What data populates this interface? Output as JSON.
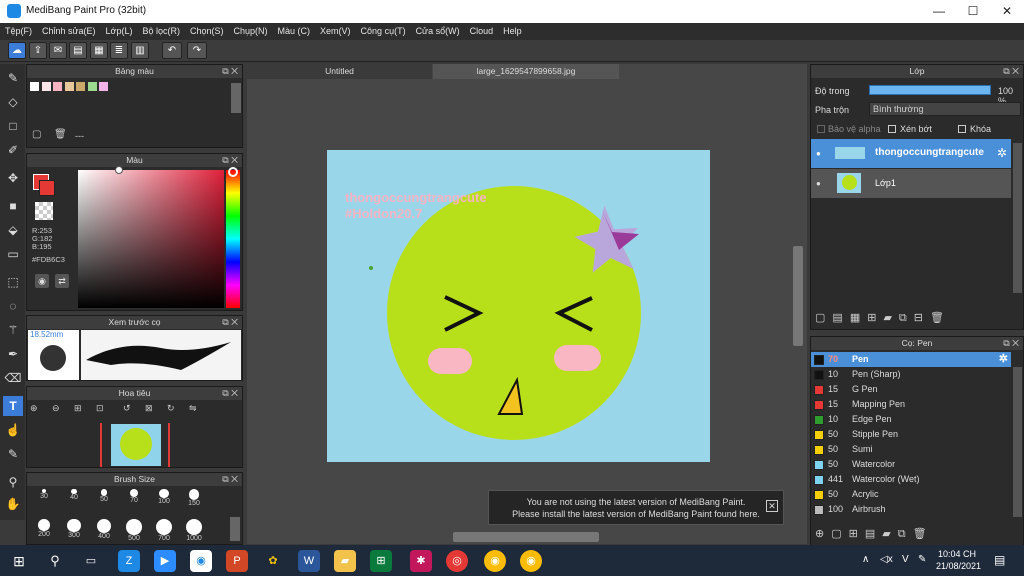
{
  "title": "MediBang Paint Pro (32bit)",
  "menu": [
    "Tệp(F)",
    "Chỉnh sửa(E)",
    "Lớp(L)",
    "Bộ lọc(R)",
    "Chọn(S)",
    "Chụp(N)",
    "Màu (C)",
    "Xem(V)",
    "Công cụ(T)",
    "Cửa sổ(W)",
    "Cloud",
    "Help"
  ],
  "panels": {
    "palette": "Bảng màu",
    "palette_count": "---",
    "color": "Màu",
    "preview": "Xem trước cọ",
    "preview_size": "18.52mm",
    "navigator": "Hoa tiêu",
    "brushsize": "Brush Size"
  },
  "color": {
    "r": "R:253",
    "g": "G:182",
    "b": "B:195",
    "hex": "#FDB6C3"
  },
  "brush_sizes": [
    "30",
    "40",
    "50",
    "70",
    "100",
    "150",
    "200",
    "300",
    "400",
    "500",
    "700",
    "1000"
  ],
  "tabs": [
    "Untitled",
    "large_1629547899658.jpg"
  ],
  "canvas_text": {
    "line1": "thongoccungtrangcute",
    "line2": "#Holdon20.7"
  },
  "layer": {
    "title": "Lớp",
    "opacity_label": "Độ trong",
    "opacity": "100 %",
    "blend_label": "Pha trộn",
    "blend": "Bình thường",
    "protect": "Bảo vệ alpha",
    "clip": "Xén bớt",
    "lock": "Khóa",
    "layers": [
      "thongoccungtrangcute",
      "Lớp1"
    ]
  },
  "pens": {
    "title": "Cọ: Pen",
    "items": [
      {
        "size": "70",
        "name": "Pen",
        "color": "#111111"
      },
      {
        "size": "10",
        "name": "Pen (Sharp)",
        "color": "#111111"
      },
      {
        "size": "15",
        "name": "G Pen",
        "color": "#e53935"
      },
      {
        "size": "15",
        "name": "Mapping Pen",
        "color": "#e53935"
      },
      {
        "size": "10",
        "name": "Edge Pen",
        "color": "#2e9e2e"
      },
      {
        "size": "50",
        "name": "Stipple Pen",
        "color": "#f5d000"
      },
      {
        "size": "50",
        "name": "Sumi",
        "color": "#f5d000"
      },
      {
        "size": "50",
        "name": "Watercolor",
        "color": "#7fd3f0"
      },
      {
        "size": "441",
        "name": "Watercolor (Wet)",
        "color": "#7fd3f0"
      },
      {
        "size": "50",
        "name": "Acrylic",
        "color": "#f5d000"
      },
      {
        "size": "100",
        "name": "Airbrush",
        "color": "#bbbbbb"
      }
    ]
  },
  "notification": {
    "line1": "You are not using the latest version of MediBang Paint.",
    "line2": "Please install the latest version of MediBang Paint found here."
  },
  "taskbar": {
    "time": "10:04 CH",
    "date": "21/08/2021",
    "lang": "V"
  }
}
